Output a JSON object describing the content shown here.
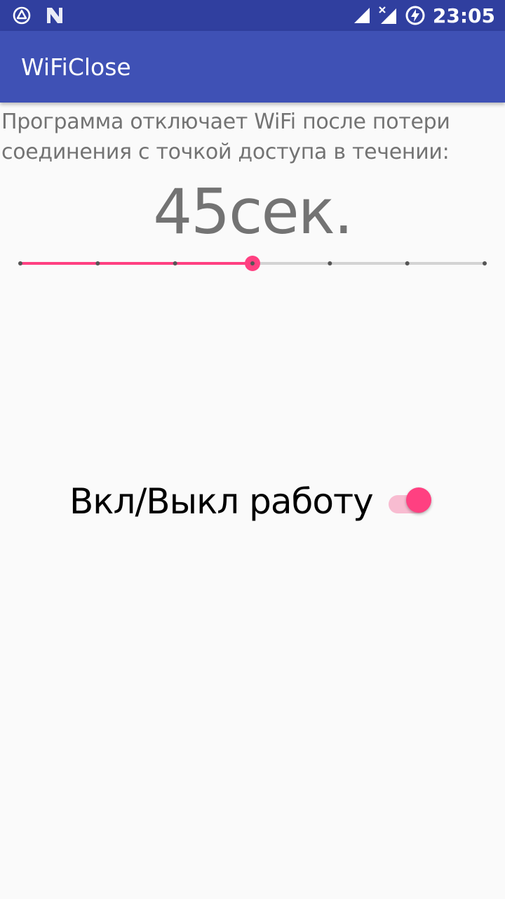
{
  "status_bar": {
    "left_icons": [
      "app-notification-icon",
      "n-notification-icon"
    ],
    "right_icons": [
      "cell-signal-icon",
      "no-data-signal-icon",
      "battery-charging-icon"
    ],
    "time": "23:05"
  },
  "app_bar": {
    "title": "WiFiClose",
    "color": "#3f51b5"
  },
  "main": {
    "description_line1": "Программа отключает WiFi после потери",
    "description_line2": "соединения с точкой доступа в течении:",
    "seconds_value": "45сек.",
    "seekbar": {
      "steps": 7,
      "selected_index": 3,
      "accent_color": "#ff4081"
    },
    "toggle": {
      "label": "Вкл/Выкл работу",
      "checked": true,
      "accent_color": "#ff4081"
    }
  },
  "colors": {
    "status_bar": "#303f9f",
    "background": "#fafafa",
    "text_secondary": "#737373"
  }
}
